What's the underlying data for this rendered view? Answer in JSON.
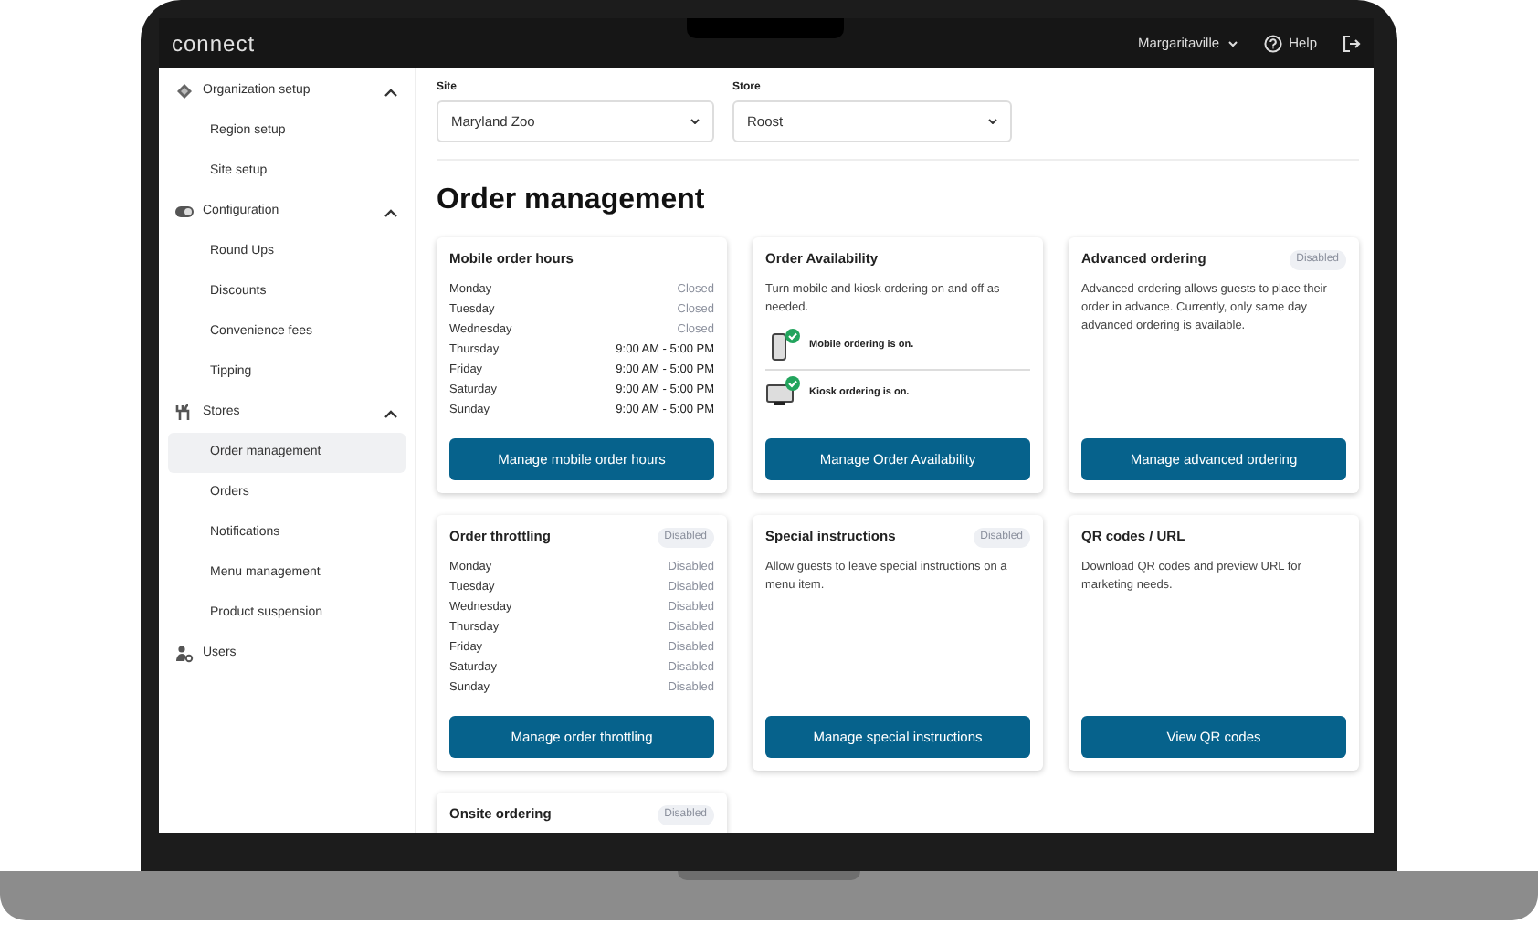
{
  "header": {
    "brand": "connect",
    "account": "Margaritaville",
    "help": "Help"
  },
  "sidebar": [
    {
      "label": "Organization setup",
      "expanded": true,
      "children": [
        {
          "label": "Region setup",
          "selected": false
        },
        {
          "label": "Site setup",
          "selected": false
        }
      ]
    },
    {
      "label": "Configuration",
      "expanded": true,
      "children": [
        {
          "label": "Round Ups",
          "selected": false
        },
        {
          "label": "Discounts",
          "selected": false
        },
        {
          "label": "Convenience fees",
          "selected": false
        },
        {
          "label": "Tipping",
          "selected": false
        }
      ]
    },
    {
      "label": "Stores",
      "expanded": true,
      "children": [
        {
          "label": "Order management",
          "selected": true
        },
        {
          "label": "Orders",
          "selected": false
        },
        {
          "label": "Notifications",
          "selected": false
        },
        {
          "label": "Menu management",
          "selected": false
        },
        {
          "label": "Product suspension",
          "selected": false
        }
      ]
    },
    {
      "label": "Users"
    }
  ],
  "filters": [
    {
      "label": "Site",
      "value": "Maryland Zoo"
    },
    {
      "label": "Store",
      "value": "Roost"
    }
  ],
  "title": "Order management",
  "cards": [
    {
      "kind": "schedule",
      "title": "Mobile order hours",
      "rows": [
        {
          "day": "Monday",
          "value": "Closed",
          "dimmed": true
        },
        {
          "day": "Tuesday",
          "value": "Closed",
          "dimmed": true
        },
        {
          "day": "Wednesday",
          "value": "Closed",
          "dimmed": true
        },
        {
          "day": "Thursday",
          "value": "9:00 AM - 5:00 PM",
          "dimmed": false
        },
        {
          "day": "Friday",
          "value": "9:00 AM - 5:00 PM",
          "dimmed": false
        },
        {
          "day": "Saturday",
          "value": "9:00 AM - 5:00 PM",
          "dimmed": false
        },
        {
          "day": "Sunday",
          "value": "9:00 AM - 5:00 PM",
          "dimmed": false
        }
      ],
      "button": "Manage mobile order hours"
    },
    {
      "kind": "availability",
      "title": "Order Availability",
      "text": "Turn mobile and kiosk ordering on and off as needed.",
      "items": [
        {
          "label": "Mobile ordering is on.",
          "on": true
        },
        {
          "label": "Kiosk ordering is on.",
          "on": true
        }
      ],
      "button": "Manage Order Availability"
    },
    {
      "kind": "text",
      "title": "Advanced ordering",
      "badge": "Disabled",
      "text": "Advanced ordering allows guests to place their order in advance. Currently, only same day advanced ordering is available.",
      "button": "Manage advanced ordering"
    },
    {
      "kind": "schedule",
      "title": "Order throttling",
      "badge": "Disabled",
      "rows": [
        {
          "day": "Monday",
          "value": "Disabled",
          "dimmed": true
        },
        {
          "day": "Tuesday",
          "value": "Disabled",
          "dimmed": true
        },
        {
          "day": "Wednesday",
          "value": "Disabled",
          "dimmed": true
        },
        {
          "day": "Thursday",
          "value": "Disabled",
          "dimmed": true
        },
        {
          "day": "Friday",
          "value": "Disabled",
          "dimmed": true
        },
        {
          "day": "Saturday",
          "value": "Disabled",
          "dimmed": true
        },
        {
          "day": "Sunday",
          "value": "Disabled",
          "dimmed": true
        }
      ],
      "button": "Manage order throttling"
    },
    {
      "kind": "text",
      "title": "Special instructions",
      "badge": "Disabled",
      "text": "Allow guests to leave special instructions on a menu item.",
      "button": "Manage special instructions"
    },
    {
      "kind": "text",
      "title": "QR codes / URL",
      "text": "Download QR codes and preview URL for marketing needs.",
      "button": "View QR codes"
    },
    {
      "kind": "text",
      "title": "Onsite ordering",
      "badge": "Disabled"
    }
  ]
}
